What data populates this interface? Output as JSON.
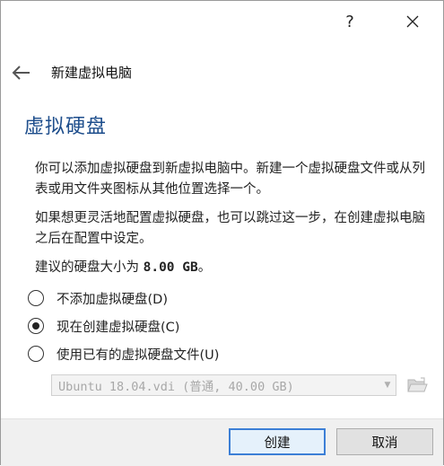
{
  "titlebar": {
    "help_label": "?",
    "close_label": "✕"
  },
  "header": {
    "back_icon": "back-arrow-icon",
    "wizard_title": "新建虚拟电脑"
  },
  "page": {
    "title": "虚拟硬盘",
    "intro_text": "你可以添加虚拟硬盘到新虚拟电脑中。新建一个虚拟硬盘文件或从列表或用文件夹图标从其他位置选择一个。",
    "skip_text": "如果想更灵活地配置虚拟硬盘，也可以跳过这一步，在创建虚拟电脑之后在配置中设定。",
    "recommend_prefix": "建议的硬盘大小为 ",
    "recommend_size": "8.00 GB",
    "recommend_suffix": "。"
  },
  "options": [
    {
      "label": "不添加虚拟硬盘(D)",
      "checked": false
    },
    {
      "label": "现在创建虚拟硬盘(C)",
      "checked": true
    },
    {
      "label": "使用已有的虚拟硬盘文件(U)",
      "checked": false
    }
  ],
  "disk_select": {
    "value": "Ubuntu 18.04.vdi (普通, 40.00 GB)",
    "enabled": false,
    "folder_icon": "folder-open-icon"
  },
  "buttons": {
    "create": "创建",
    "cancel": "取消"
  },
  "colors": {
    "title_blue": "#1e4e8c",
    "primary_border": "#3c7fd6"
  }
}
